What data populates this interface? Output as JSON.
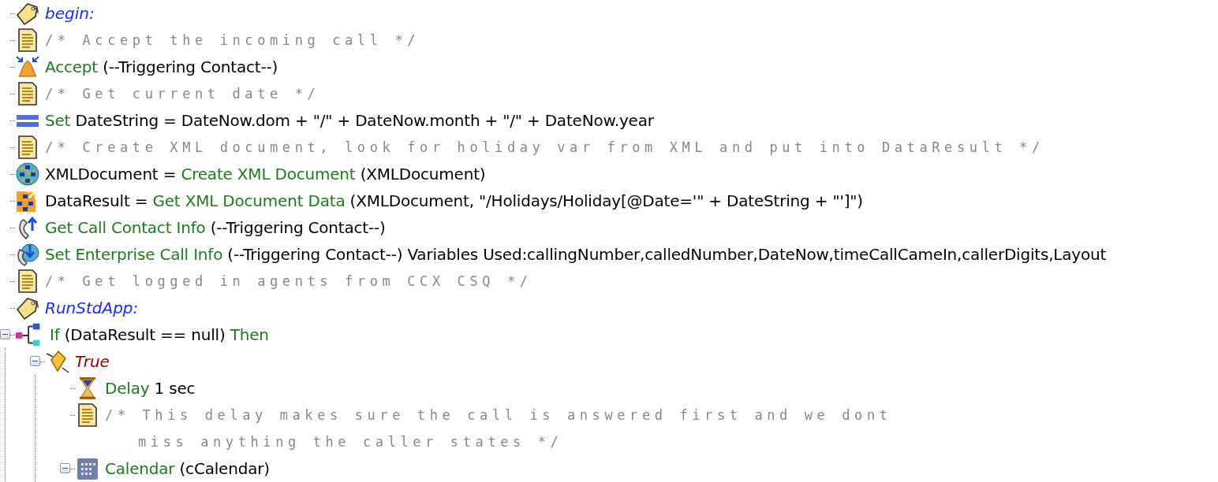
{
  "script_tree": [
    {
      "kind": "label",
      "text": "begin:"
    },
    {
      "kind": "comment",
      "text": "/* Accept the incoming call */"
    },
    {
      "kind": "accept",
      "parts": [
        {
          "kind": "keyword",
          "text": "Accept"
        },
        {
          "kind": "plain",
          "text": "(--Triggering Contact--)"
        }
      ]
    },
    {
      "kind": "comment",
      "text": "/* Get current date */"
    },
    {
      "kind": "set",
      "parts": [
        {
          "kind": "keyword",
          "text": "Set"
        },
        {
          "kind": "plain",
          "text": "DateString = DateNow.dom + \"/\" + DateNow.month + \"/\" + DateNow.year"
        }
      ]
    },
    {
      "kind": "comment",
      "text": "/* Create XML document, look for holiday var from XML and put into DataResult */"
    },
    {
      "kind": "xmlcreate",
      "parts": [
        {
          "kind": "plain",
          "text": "XMLDocument ="
        },
        {
          "kind": "keyword",
          "text": "Create XML Document"
        },
        {
          "kind": "plain",
          "text": "(XMLDocument)"
        }
      ]
    },
    {
      "kind": "xmlget",
      "parts": [
        {
          "kind": "plain",
          "text": "DataResult ="
        },
        {
          "kind": "keyword",
          "text": "Get XML Document Data"
        },
        {
          "kind": "plain",
          "text": "(XMLDocument, \"/Holidays/Holiday[@Date='\" + DateString + \"']\")"
        }
      ]
    },
    {
      "kind": "contactget",
      "parts": [
        {
          "kind": "keyword",
          "text": "Get Call Contact Info"
        },
        {
          "kind": "plain",
          "text": "(--Triggering Contact--)"
        }
      ]
    },
    {
      "kind": "contactset",
      "parts": [
        {
          "kind": "keyword",
          "text": "Set Enterprise Call Info"
        },
        {
          "kind": "plain",
          "text": "(--Triggering Contact--) Variables Used:callingNumber,calledNumber,DateNow,timeCallCameIn,callerDigits,Layout"
        }
      ]
    },
    {
      "kind": "comment",
      "text": "/* Get logged in agents from CCX CSQ */"
    },
    {
      "kind": "label",
      "text": "RunStdApp:"
    },
    {
      "kind": "if",
      "expanded": true,
      "parts": [
        {
          "kind": "keyword",
          "text": "If"
        },
        {
          "kind": "plain",
          "text": "(DataResult == null)"
        },
        {
          "kind": "keyword",
          "text": "Then"
        }
      ],
      "children": [
        {
          "kind": "branch",
          "text": "True",
          "expanded": true,
          "children": [
            {
              "kind": "delay",
              "parts": [
                {
                  "kind": "keyword",
                  "text": "Delay"
                },
                {
                  "kind": "plain",
                  "text": "1 sec"
                }
              ]
            },
            {
              "kind": "comment",
              "text": "/* This delay makes sure the call is answered first and we dont\nmiss anything the caller states */"
            },
            {
              "kind": "calendar",
              "expanded": true,
              "parts": [
                {
                  "kind": "keyword",
                  "text": "Calendar"
                },
                {
                  "kind": "plain",
                  "text": "(cCalendar)"
                }
              ]
            }
          ]
        }
      ]
    }
  ]
}
